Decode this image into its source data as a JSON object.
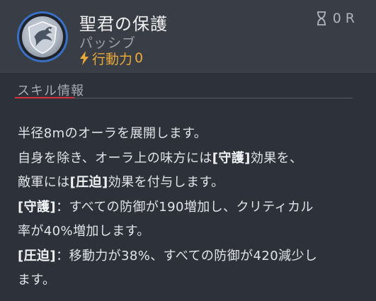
{
  "skill": {
    "name": "聖君の保護",
    "type": "パッシブ",
    "ap_label": "行動力",
    "ap_value": "0",
    "cooldown_value": "0",
    "cooldown_unit": "R",
    "icons": {
      "portrait": "eagle-shield-emblem-icon",
      "action_point": "lightning-bolt-icon",
      "cooldown": "hourglass-icon"
    }
  },
  "section": {
    "title": "スキル情報"
  },
  "description": {
    "line1": "半径8mのオーラを展開します。",
    "line2": {
      "pre": "自身を除き、オーラ上の味方には",
      "tag": "[守護]",
      "post": "効果を、"
    },
    "line3": {
      "pre": "敵軍には",
      "tag": "[圧迫]",
      "post": "効果を付与します。"
    },
    "line4": {
      "tag": "[守護]",
      "post": "：すべての防御が190増加し、クリティカル"
    },
    "line5": "率が40%増加します。",
    "line6": {
      "tag": "[圧迫]",
      "post": "：移動力が38%、すべての防御が420減少し"
    },
    "line7": "ます。"
  },
  "colors": {
    "accent_orange": "#e9a93b",
    "tab_underline_red": "#d8323e",
    "portrait_ring_blue": "#3a6fc4"
  }
}
